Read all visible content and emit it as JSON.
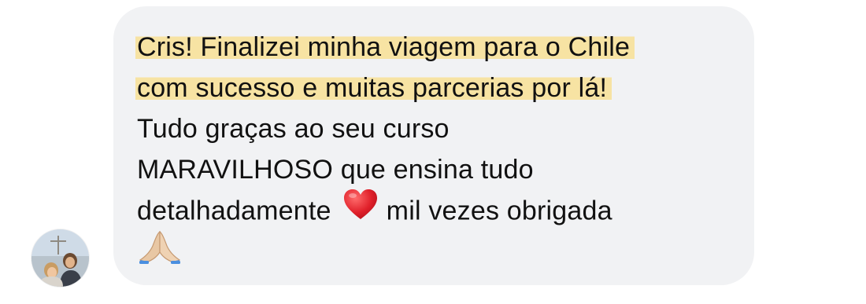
{
  "message": {
    "highlighted_lines": [
      "Cris! Finalizei minha viagem para o Chile",
      "com sucesso e muitas parcerias por lá!"
    ],
    "plain_lines": [
      "Tudo graças ao seu curso",
      "MARAVILHOSO que ensina tudo"
    ],
    "line5_before": "detalhadamente",
    "line5_after": "mil vezes obrigada",
    "heart_emoji": "heart-icon",
    "pray_emoji": "praying-hands-icon",
    "highlight_color": "#f7e3a3",
    "bubble_color": "#f1f2f4"
  }
}
